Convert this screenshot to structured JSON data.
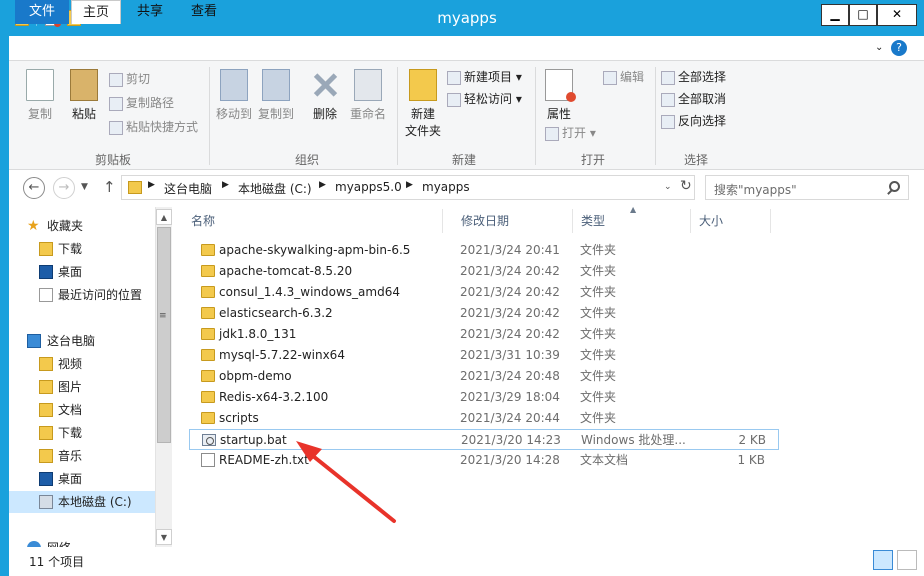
{
  "window": {
    "title": "myapps",
    "buttons": {
      "minimize": "▁",
      "maximize": "□",
      "close": "✕"
    }
  },
  "ribbon_tabs": [
    "文件",
    "主页",
    "共享",
    "查看"
  ],
  "ribbon": {
    "clipboard": {
      "copy": "复制",
      "paste": "粘贴",
      "cut": "剪切",
      "copy_path": "复制路径",
      "paste_shortcut": "粘贴快捷方式",
      "label": "剪贴板"
    },
    "organize": {
      "move_to": "移动到",
      "copy_to": "复制到",
      "delete": "删除",
      "rename": "重命名",
      "label": "组织"
    },
    "new": {
      "new_folder": "新建\n文件夹",
      "new_folder_line1": "新建",
      "new_folder_line2": "文件夹",
      "new_item": "新建项目",
      "easy_access": "轻松访问",
      "label": "新建"
    },
    "open": {
      "properties": "属性",
      "open": "打开",
      "edit": "编辑",
      "label": "打开"
    },
    "select": {
      "select_all": "全部选择",
      "select_none": "全部取消",
      "invert": "反向选择",
      "label": "选择"
    }
  },
  "address": {
    "crumbs": [
      "这台电脑",
      "本地磁盘 (C:)",
      "myapps5.0",
      "myapps"
    ],
    "search_placeholder": "搜索\"myapps\""
  },
  "nav_pane": {
    "items": [
      {
        "label": "收藏夹",
        "icon": "star-icon"
      },
      {
        "label": "下载",
        "icon": "folder-icon"
      },
      {
        "label": "桌面",
        "icon": "desktop-icon"
      },
      {
        "label": "最近访问的位置",
        "icon": "recent-icon"
      },
      {
        "label": "这台电脑",
        "icon": "pc-icon"
      },
      {
        "label": "视频",
        "icon": "folder-icon"
      },
      {
        "label": "图片",
        "icon": "folder-icon"
      },
      {
        "label": "文档",
        "icon": "folder-icon"
      },
      {
        "label": "下载",
        "icon": "folder-icon"
      },
      {
        "label": "音乐",
        "icon": "folder-icon"
      },
      {
        "label": "桌面",
        "icon": "desktop-icon"
      },
      {
        "label": "本地磁盘 (C:)",
        "icon": "drive-icon"
      },
      {
        "label": "网络",
        "icon": "network-icon"
      }
    ]
  },
  "columns": [
    "名称",
    "修改日期",
    "类型",
    "大小"
  ],
  "files": [
    {
      "name": "apache-skywalking-apm-bin-6.5",
      "date": "2021/3/24 20:41",
      "type": "文件夹",
      "size": "",
      "kind": "folder"
    },
    {
      "name": "apache-tomcat-8.5.20",
      "date": "2021/3/24 20:42",
      "type": "文件夹",
      "size": "",
      "kind": "folder"
    },
    {
      "name": "consul_1.4.3_windows_amd64",
      "date": "2021/3/24 20:42",
      "type": "文件夹",
      "size": "",
      "kind": "folder"
    },
    {
      "name": "elasticsearch-6.3.2",
      "date": "2021/3/24 20:42",
      "type": "文件夹",
      "size": "",
      "kind": "folder"
    },
    {
      "name": "jdk1.8.0_131",
      "date": "2021/3/24 20:42",
      "type": "文件夹",
      "size": "",
      "kind": "folder"
    },
    {
      "name": "mysql-5.7.22-winx64",
      "date": "2021/3/31 10:39",
      "type": "文件夹",
      "size": "",
      "kind": "folder"
    },
    {
      "name": "obpm-demo",
      "date": "2021/3/24 20:48",
      "type": "文件夹",
      "size": "",
      "kind": "folder"
    },
    {
      "name": "Redis-x64-3.2.100",
      "date": "2021/3/29 18:04",
      "type": "文件夹",
      "size": "",
      "kind": "folder"
    },
    {
      "name": "scripts",
      "date": "2021/3/24 20:44",
      "type": "文件夹",
      "size": "",
      "kind": "folder"
    },
    {
      "name": "startup.bat",
      "date": "2021/3/20 14:23",
      "type": "Windows 批处理...",
      "size": "2 KB",
      "kind": "bat"
    },
    {
      "name": "README-zh.txt",
      "date": "2021/3/20 14:28",
      "type": "文本文档",
      "size": "1 KB",
      "kind": "txt"
    }
  ],
  "status": {
    "count": "11 个项目"
  },
  "colors": {
    "accent": "#1aa1dc",
    "file_tab": "#1979ca",
    "annotation_arrow": "#e8332a"
  }
}
